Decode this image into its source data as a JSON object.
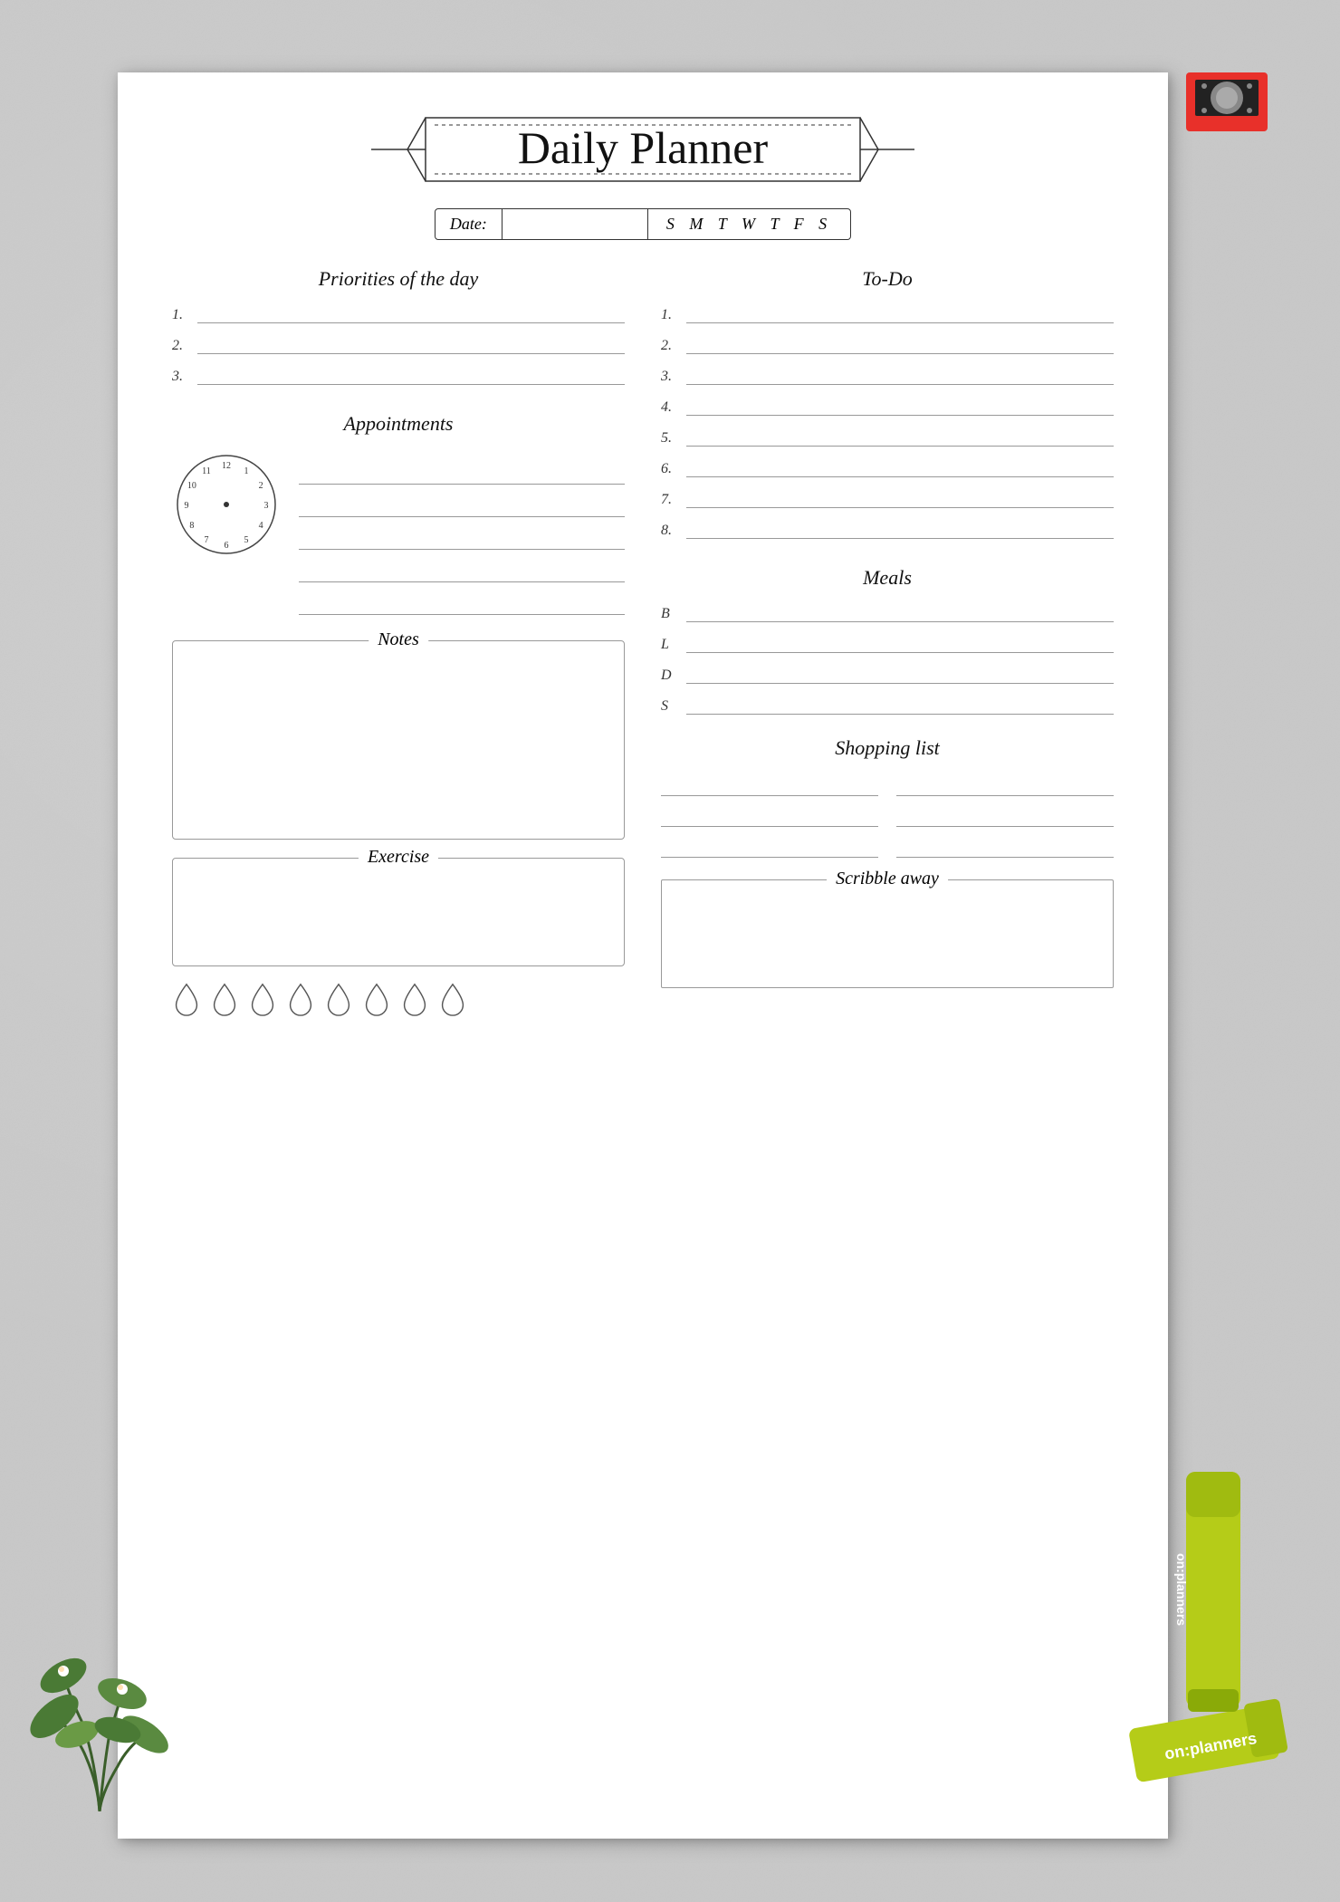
{
  "page": {
    "title": "Daily Planner",
    "background_color": "#c8c8c8",
    "paper_color": "#ffffff"
  },
  "header": {
    "title": "Daily Planner",
    "date_label": "Date:",
    "days": "S  M  T  W  T  F  S"
  },
  "priorities": {
    "title": "Priorities of the day",
    "items": [
      "1.",
      "2.",
      "3."
    ]
  },
  "appointments": {
    "title": "Appointments",
    "line_count": 5,
    "clock_numbers": [
      "12",
      "1",
      "2",
      "3",
      "4",
      "5",
      "6",
      "7",
      "8",
      "9",
      "10",
      "11"
    ]
  },
  "notes": {
    "title": "Notes"
  },
  "exercise": {
    "title": "Exercise",
    "water_label": "water drops",
    "drop_count": 8
  },
  "todo": {
    "title": "To-Do",
    "items": [
      "1.",
      "2.",
      "3.",
      "4.",
      "5.",
      "6.",
      "7.",
      "8."
    ]
  },
  "meals": {
    "title": "Meals",
    "items": [
      {
        "letter": "B"
      },
      {
        "letter": "L"
      },
      {
        "letter": "D"
      },
      {
        "letter": "S"
      }
    ]
  },
  "shopping": {
    "title": "Shopping list",
    "line_count": 6
  },
  "scribble": {
    "title": "Scribble away"
  },
  "branding": {
    "text": "on:planners"
  }
}
